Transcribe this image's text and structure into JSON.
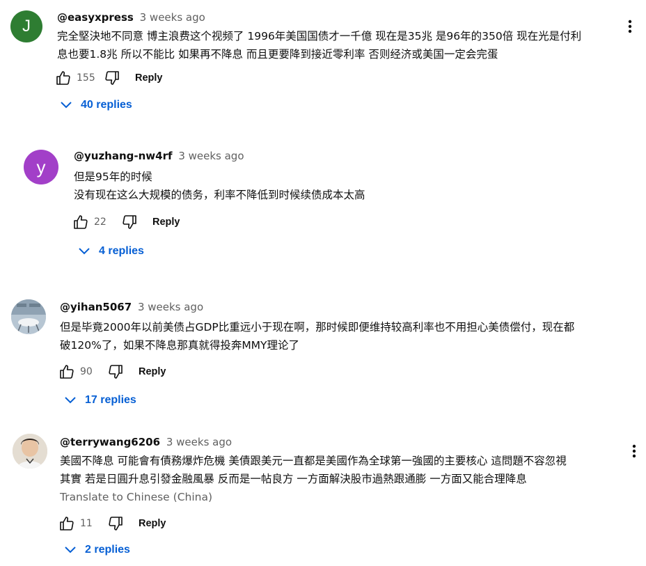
{
  "comments": [
    {
      "avatar_letter": "J",
      "avatar_color": "#2e7d32",
      "handle": "@easyxpress",
      "time": "3 weeks ago",
      "lines": [
        "完全堅決地不同意 博主浪费这个视频了 1996年美国国债才一千億 现在是35兆 是96年的350倍 现在光是付利",
        "息也要1.8兆 所以不能比 如果再不降息 而且更要降到接近零利率 否则经济或美国一定会完蛋"
      ],
      "likes": "155",
      "reply_label": "Reply",
      "replies_label": "40 replies"
    },
    {
      "avatar_letter": "y",
      "avatar_color": "#a23fc8",
      "handle": "@yuzhang-nw4rf",
      "time": "3 weeks ago",
      "lines": [
        "但是95年的时候",
        "没有现在这么大规模的债务，利率不降低到时候续债成本太高"
      ],
      "likes": "22",
      "reply_label": "Reply",
      "replies_label": "4 replies"
    },
    {
      "handle": "@yihan5067",
      "time": "3 weeks ago",
      "lines": [
        "但是毕竟2000年以前美债占GDP比重远小于现在啊，那时候即便维持较高利率也不用担心美债偿付，现在都",
        "破120%了，如果不降息那真就得投奔MMY理论了"
      ],
      "likes": "90",
      "reply_label": "Reply",
      "replies_label": "17 replies"
    },
    {
      "handle": "@terrywang6206",
      "time": "3 weeks ago",
      "lines": [
        "美國不降息 可能會有債務爆炸危機 美債跟美元一直都是美國作為全球第一強國的主要核心 這問題不容忽視",
        "其實 若是日圓升息引發金融風暴 反而是一帖良方 一方面解決股市過熱跟通膨 一方面又能合理降息"
      ],
      "translate_label": "Translate to Chinese (China)",
      "likes": "11",
      "reply_label": "Reply",
      "replies_label": "2 replies"
    }
  ]
}
